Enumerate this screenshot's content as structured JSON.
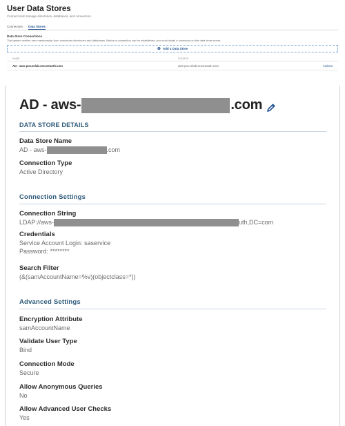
{
  "top": {
    "title": "User Data Stores",
    "subtitle": "Connect and manage directories, databases, and connectors.",
    "tabs": [
      {
        "label": "Connectors",
        "active": false
      },
      {
        "label": "Data Stores",
        "active": true
      }
    ],
    "connections_heading": "Data Store Connections",
    "connections_desc": "The system verifies user membership from connected directories and databases. Before a connection can be established, you must install a connector on the data store server.",
    "add_label": "Add a Data Store",
    "table": {
      "headers": [
        "NAME",
        "SOURCE"
      ],
      "rows": [
        {
          "name": "AD - aws-pov.zelab.secureauth.com",
          "source": "aws-pov.zelab.secureauth.com",
          "action": "Actions"
        }
      ]
    }
  },
  "detail": {
    "title_prefix": "AD - aws-",
    "title_suffix": ".com",
    "sections": {
      "details": "DATA STORE DETAILS",
      "connection": "Connection Settings",
      "advanced": "Advanced Settings"
    },
    "fields": {
      "store_name": {
        "label": "Data Store Name",
        "prefix": "AD - aws-",
        "suffix": ".com"
      },
      "connection_type": {
        "label": "Connection Type",
        "value": "Active Directory"
      },
      "connection_string": {
        "label": "Connection String",
        "prefix": "LDAP://aws-",
        "suffix": "uth,DC=com"
      },
      "credentials": {
        "label": "Credentials",
        "login": "Service Account Login: saservice",
        "password": "Password: ********"
      },
      "search_filter": {
        "label": "Search Filter",
        "value": "(&(samAccountName=%v)(objectclass=*))"
      },
      "encryption": {
        "label": "Encryption Attribute",
        "value": "samAccountName"
      },
      "validate": {
        "label": "Validate User Type",
        "value": "Bind"
      },
      "mode": {
        "label": "Connection Mode",
        "value": "Secure"
      },
      "anonymous": {
        "label": "Allow Anonymous Queries",
        "value": "No"
      },
      "advanced_checks": {
        "label": "Allow Advanced User Checks",
        "value": "Yes"
      }
    }
  },
  "colors": {
    "accent": "#1d4f91",
    "section": "#2e5a7a",
    "redaction": "#8f8f8f"
  },
  "icons": {
    "edit": "pencil-icon",
    "add": "plus-icon"
  }
}
